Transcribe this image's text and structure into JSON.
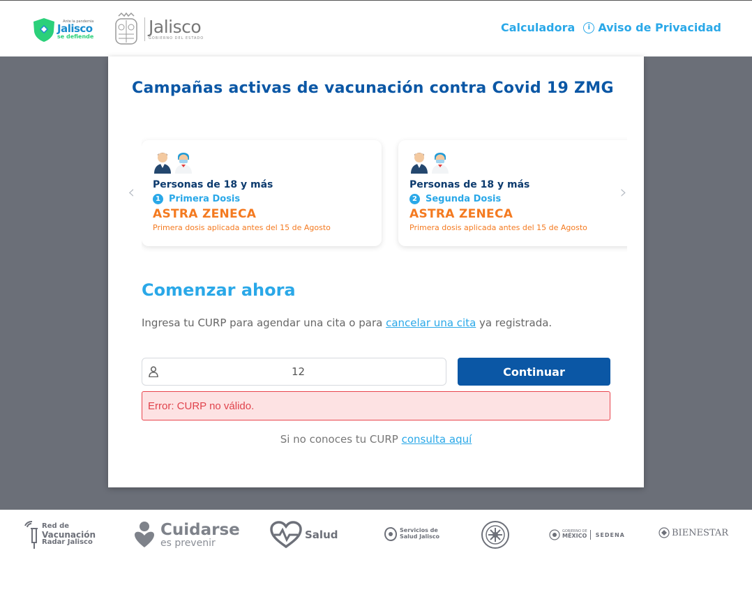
{
  "header": {
    "logo_defiende": {
      "small": "Ante la pandemia",
      "name": "Jalisco",
      "sub": "se defiende"
    },
    "logo_gobierno": {
      "name": "Jalisco",
      "sub": "GOBIERNO DEL ESTADO"
    },
    "nav": {
      "calculator": "Calculadora",
      "privacy": "Aviso de Privacidad",
      "info_icon_glyph": "i"
    }
  },
  "colors": {
    "primary": "#0b57a5",
    "accent": "#2aa8e8",
    "vaccine": "#f47a20",
    "error": "#e0434c",
    "error_bg": "#fde2e3",
    "overlay": "#6b6f78"
  },
  "panel": {
    "title": "Campañas activas de vacunación contra Covid 19 ZMG",
    "carousel": {
      "prev_glyph": "‹",
      "next_glyph": "›",
      "cards": [
        {
          "group": "Personas de 18 y más",
          "dose_number": "1",
          "dose": "Primera Dosis",
          "vaccine": "ASTRA ZENECA",
          "note": "Primera dosis aplicada antes del 15 de Agosto"
        },
        {
          "group": "Personas de 18 y más",
          "dose_number": "2",
          "dose": "Segunda Dosis",
          "vaccine": "ASTRA ZENECA",
          "note": "Primera dosis aplicada antes del 15 de Agosto"
        }
      ]
    },
    "start": {
      "title": "Comenzar ahora",
      "intro_before": "Ingresa tu CURP para agendar una cita o para ",
      "intro_link": "cancelar una cita",
      "intro_after": " ya registrada.",
      "curp_value": "12",
      "continue_label": "Continuar",
      "error": "Error: CURP no válido.",
      "help_text": "Si no conoces tu CURP ",
      "help_link": "consulta aquí"
    }
  },
  "footer": {
    "logos": {
      "radar": {
        "line1": "Red de",
        "line2": "Vacunación",
        "line3": "Radar Jalisco"
      },
      "cuidarse": {
        "name": "Cuidarse",
        "sub": "es prevenir"
      },
      "salud": "Salud",
      "servicios": {
        "line1": "Servicios de",
        "line2": "Salud Jalisco"
      },
      "mexico": {
        "line1": "GOBIERNO DE",
        "line2": "MÉXICO",
        "sedena": "SEDENA"
      },
      "bienestar": "BIENESTAR"
    }
  }
}
